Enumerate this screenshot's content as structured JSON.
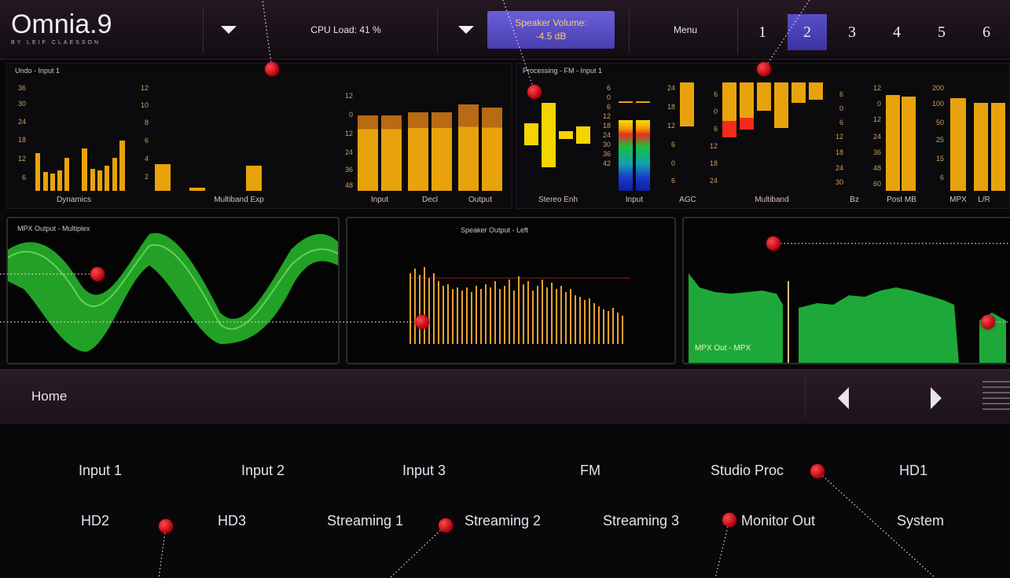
{
  "logo": {
    "name": "Omnia.9",
    "sub": "BY LEIF CLAESSON"
  },
  "topbar": {
    "cpu_load": "CPU Load: 41 %",
    "speaker_volume_line1": "Speaker Volume:",
    "speaker_volume_line2": "-4.5 dB",
    "menu": "Menu",
    "presets": [
      "1",
      "2",
      "3",
      "4",
      "5",
      "6"
    ],
    "active_preset": "2"
  },
  "left_panel": {
    "title": "Undo - Input 1",
    "dynamics_label": "Dynamics",
    "multiband_exp_label": "Multiband Exp",
    "input_label": "Input",
    "decl_label": "Decl",
    "output_label": "Output",
    "dyn_ticks": [
      "36",
      "30",
      "24",
      "18",
      "12",
      "6"
    ],
    "mbexp_ticks": [
      "12",
      "10",
      "8",
      "6",
      "4",
      "2"
    ],
    "io_ticks": [
      "12",
      "0",
      "12",
      "24",
      "36",
      "48"
    ]
  },
  "right_panel": {
    "title": "Processing - FM - Input 1",
    "stereo_enh_label": "Stereo Enh",
    "input_label": "Input",
    "agc_label": "AGC",
    "multiband_label": "Multiband",
    "bz_label": "Bz",
    "post_mb_label": "Post MB",
    "mpx_label": "MPX",
    "lr_label": "L/R",
    "input_ticks": [
      "6",
      "0",
      "6",
      "12",
      "18",
      "24",
      "30",
      "36",
      "42"
    ],
    "agc_ticks": [
      "24",
      "18",
      "12",
      "6",
      "0",
      "6"
    ],
    "mb_ticks": [
      "6",
      "0",
      "6",
      "12",
      "18",
      "24"
    ],
    "bz_ticks": [
      "6",
      "0",
      "6",
      "12",
      "18",
      "24",
      "30"
    ],
    "post_ticks": [
      "12",
      "0",
      "12",
      "24",
      "36",
      "48",
      "60"
    ],
    "mpx_ticks": [
      "200",
      "100",
      "50",
      "25",
      "15",
      "6"
    ]
  },
  "scopes": {
    "mpx_title": "MPX Output - Multiplex",
    "speaker_title": "Speaker Output - Left",
    "rds_label": "MPX Out - MPX"
  },
  "nav": {
    "home": "Home"
  },
  "menu": {
    "row1": [
      "Input 1",
      "Input 2",
      "Input 3",
      "FM",
      "Studio Proc",
      "HD1"
    ],
    "row2": [
      "HD2",
      "HD3",
      "Streaming 1",
      "Streaming 2",
      "Streaming 3",
      "Monitor Out",
      "System"
    ]
  }
}
